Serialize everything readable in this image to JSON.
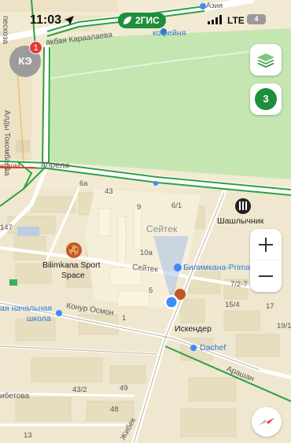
{
  "status_bar": {
    "time": "11:03",
    "network": "LTE",
    "battery": "4",
    "brand": "2ГИС"
  },
  "profile": {
    "initials": "КЭ",
    "badge": "1"
  },
  "layers_counter": "3",
  "map_labels": {
    "azia": "Азия",
    "kofeynya": "кофейня",
    "karalaeva": "акбая Караалаева",
    "tokombaeva": "Алды Токомбаева",
    "pesoza": "пескоза",
    "aprelya": "апреля",
    "domi": "юдом",
    "b6a": "6а",
    "b43": "43",
    "b9": "9",
    "b6_1": "6/1",
    "b147": "147",
    "seitek_area": "Сейтек",
    "shashlychnik": "Шашлычник",
    "bilimkana_sport": "Bilimkana Sport",
    "space": "Space",
    "b10a": "10а",
    "seitek_street": "Сейтек",
    "bilimkana_prima": "Билимкана-Prima",
    "b7_2": "7/2-7",
    "b5": "5",
    "nachalnaya": "ая начальная",
    "shkola": "школа",
    "konur": "Конур Осмон",
    "b15_4": "15/4",
    "b17": "17",
    "b1": "1",
    "iskender": "Искендер",
    "b19": "19/1",
    "dachef": "Dachef",
    "arashan": "Арашан",
    "b43_2": "43/2",
    "b49": "49",
    "betova": "ибетова",
    "b48": "48",
    "zhibek": "Жибек",
    "b13": "13"
  },
  "colors": {
    "park": "#bfe3a9",
    "ground": "#f2ead2",
    "brand_green": "#1e8f3c",
    "location_dot": "#3d8bfd",
    "road": "#ffffff"
  },
  "icons": [
    "location-arrow-icon",
    "brand-leaf-icon",
    "signal-icon",
    "layers-icon",
    "plus-icon",
    "minus-icon",
    "compass-icon",
    "pizza-icon",
    "grill-icon",
    "shopping-cart-icon"
  ]
}
